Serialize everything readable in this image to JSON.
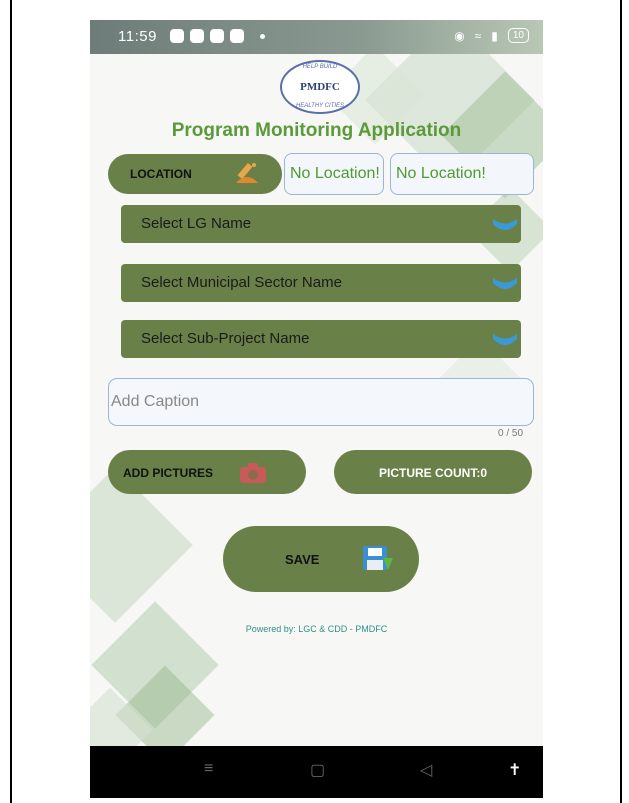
{
  "status_bar": {
    "time": "11:59",
    "battery": "10"
  },
  "logo": {
    "arc_top": "HELP BUILD",
    "main": "PMDFC",
    "arc_bottom": "HEALTHY CITIES"
  },
  "app_title": "Program Monitoring Application",
  "location": {
    "button_label": "LOCATION",
    "field_1_value": "No Location!",
    "field_2_value": "No Location!"
  },
  "dropdowns": [
    {
      "label": "Select LG Name"
    },
    {
      "label": "Select Municipal Sector Name"
    },
    {
      "label": "Select Sub-Project Name"
    }
  ],
  "caption": {
    "placeholder": "Add Caption",
    "counter": "0 / 50"
  },
  "buttons": {
    "add_pictures": "ADD PICTURES",
    "picture_count": "PICTURE COUNT:0",
    "save": "SAVE"
  },
  "footer_text": "Powered by: LGC & CDD -  PMDFC",
  "colors": {
    "button_green": "#6a8049",
    "title_green": "#5a9a3a",
    "field_text_green": "#4f9a31",
    "footer_teal": "#2f8f86",
    "chevron_blue": "#3a9ad8"
  }
}
